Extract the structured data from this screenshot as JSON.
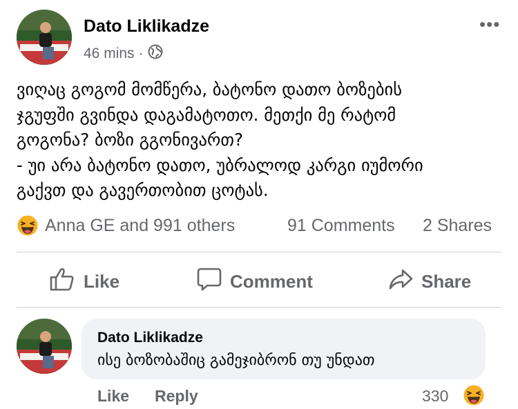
{
  "post": {
    "author": "Dato Liklikadze",
    "time": "46 mins",
    "separator": "·",
    "audience_icon": "globe-icon",
    "more_label": "•••",
    "text": "ვიღაც გოგომ მომწერა, ბატონო დათო ბოზების\nჯგუფში გვინდა დაგამატოთო. მეთქი მე რატომ\nგოგონა? ბოზი გგონივართ?\n- უი არა ბატონო დათო, უბრალოდ კარგი იუმორი\nგაქვთ და გავერთობით ცოტას."
  },
  "stats": {
    "reaction_icon": "laughing-emoji-icon",
    "reactions": "Anna GE and 991 others",
    "comments": "91 Comments",
    "shares": "2 Shares"
  },
  "actions": {
    "like": "Like",
    "comment": "Comment",
    "share": "Share"
  },
  "comment": {
    "author": "Dato Liklikadze",
    "text": "ისე ბოზობაშიც გამეჯიბრონ თუ უნდათ",
    "like": "Like",
    "reply": "Reply",
    "reaction_count": "330",
    "reaction_icon": "laughing-emoji-icon"
  },
  "colors": {
    "secondary_text": "#65676b",
    "bubble_bg": "#f0f2f5",
    "divider": "#ced0d4",
    "emoji_yellow": "#f7b125"
  }
}
